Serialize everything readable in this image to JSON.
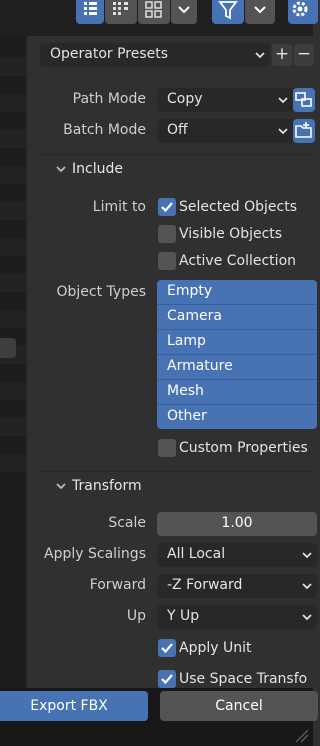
{
  "colors": {
    "accent": "#4772b3",
    "panel": "#303030",
    "field": "#282828"
  },
  "header": {
    "icons": [
      "list-view-icon",
      "thumbnail-view-icon",
      "grid-view-icon",
      "chevron-down-icon",
      "filter-icon",
      "chevron-down-icon",
      "settings-gear-icon"
    ]
  },
  "operator_presets": {
    "label": "Operator Presets",
    "add": "+",
    "remove": "−"
  },
  "path_mode": {
    "label": "Path Mode",
    "value": "Copy"
  },
  "batch_mode": {
    "label": "Batch Mode",
    "value": "Off"
  },
  "include": {
    "title": "Include",
    "limit_to_label": "Limit to",
    "limit_options": [
      {
        "label": "Selected Objects",
        "checked": true
      },
      {
        "label": "Visible Objects",
        "checked": false
      },
      {
        "label": "Active Collection",
        "checked": false
      }
    ],
    "object_types_label": "Object Types",
    "object_types": [
      "Empty",
      "Camera",
      "Lamp",
      "Armature",
      "Mesh",
      "Other"
    ],
    "custom_properties": {
      "label": "Custom Properties",
      "checked": false
    }
  },
  "transform": {
    "title": "Transform",
    "scale_label": "Scale",
    "scale_value": "1.00",
    "apply_scalings_label": "Apply Scalings",
    "apply_scalings_value": "All Local",
    "forward_label": "Forward",
    "forward_value": "-Z Forward",
    "up_label": "Up",
    "up_value": "Y Up",
    "apply_unit": {
      "label": "Apply Unit",
      "checked": true
    },
    "use_space_transform": {
      "label": "Use Space Transfo",
      "checked": true
    }
  },
  "footer": {
    "export_label": "Export FBX",
    "cancel_label": "Cancel"
  }
}
